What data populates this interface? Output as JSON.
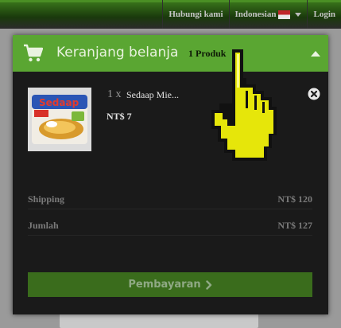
{
  "topnav": {
    "contact": "Hubungi kami",
    "language": "Indonesian",
    "login": "Login"
  },
  "cart": {
    "title": "Keranjang belanja",
    "count_label": "1 Produk",
    "item": {
      "quantity_label": "1 x",
      "name": "Sedaap Mie...",
      "price": "NT$ 7",
      "thumb_brand": "Sedaap"
    },
    "shipping": {
      "label": "Shipping",
      "value": "NT$ 120"
    },
    "total": {
      "label": "Jumlah",
      "value": "NT$ 127"
    },
    "checkout_label": "Pembayaran"
  },
  "colors": {
    "header_green": "#5aa632",
    "button_green": "#3a6c1c",
    "panel_bg": "#1a1a1a",
    "cursor_yellow": "#e6e60a"
  },
  "icons": {
    "cart": "shopping-cart-icon",
    "collapse": "chevron-up-icon",
    "remove": "close-circle-icon",
    "checkout": "chevron-right-icon",
    "pointer": "hand-pointer-cursor"
  }
}
